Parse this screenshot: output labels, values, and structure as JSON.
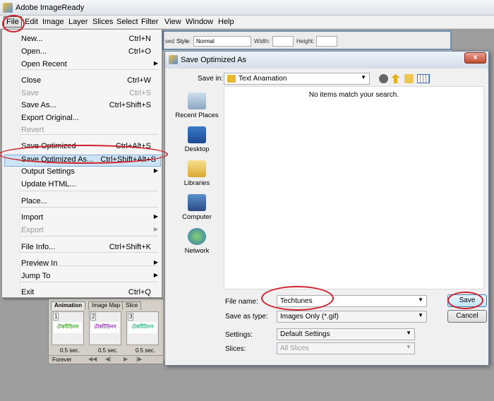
{
  "app": {
    "title": "Adobe ImageReady"
  },
  "menubar": [
    "File",
    "Edit",
    "Image",
    "Layer",
    "Slices",
    "Select",
    "Filter",
    "View",
    "Window",
    "Help"
  ],
  "options_bar": {
    "partial_label": "sed",
    "style_label": "Style:",
    "style_value": "Normal",
    "width_label": "Width:",
    "height_label": "Height:"
  },
  "file_menu": [
    {
      "label": "New...",
      "shortcut": "Ctrl+N"
    },
    {
      "label": "Open...",
      "shortcut": "Ctrl+O"
    },
    {
      "label": "Open Recent",
      "submenu": true
    },
    {
      "label": "Close",
      "shortcut": "Ctrl+W"
    },
    {
      "label": "Save",
      "shortcut": "Ctrl+S",
      "disabled": true
    },
    {
      "label": "Save As...",
      "shortcut": "Ctrl+Shift+S"
    },
    {
      "label": "Export Original...",
      "shortcut": ""
    },
    {
      "label": "Revert",
      "disabled": true
    },
    {
      "label": "Save Optimized",
      "shortcut": "Ctrl+Alt+S"
    },
    {
      "label": "Save Optimized As...",
      "shortcut": "Ctrl+Shift+Alt+S",
      "highlighted": true
    },
    {
      "label": "Output Settings",
      "submenu": true
    },
    {
      "label": "Update HTML..."
    },
    {
      "label": "Place..."
    },
    {
      "label": "Import",
      "submenu": true
    },
    {
      "label": "Export",
      "submenu": true,
      "disabled": true
    },
    {
      "label": "File Info...",
      "shortcut": "Ctrl+Shift+K"
    },
    {
      "label": "Preview In",
      "submenu": true
    },
    {
      "label": "Jump To",
      "submenu": true
    },
    {
      "label": "Exit",
      "shortcut": "Ctrl+Q"
    }
  ],
  "animation_panel": {
    "tabs": [
      "Animation",
      "Image Map",
      "Slice"
    ],
    "frames": [
      {
        "num": "1",
        "text": "টেকটিউনস",
        "color": "#3aa020",
        "delay": "0.5 sec."
      },
      {
        "num": "2",
        "text": "টেকটিউনস",
        "color": "#9a20c0",
        "delay": "0.5 sec."
      },
      {
        "num": "3",
        "text": "টেকটিউনস",
        "color": "#20b080",
        "delay": "0.5 sec."
      }
    ],
    "loop": "Forever"
  },
  "dialog": {
    "title": "Save Optimized As",
    "close": "x",
    "save_in_label": "Save in:",
    "save_in_value": "Text Anamation",
    "places": [
      "Recent Places",
      "Desktop",
      "Libraries",
      "Computer",
      "Network"
    ],
    "empty_message": "No items match your search.",
    "file_name_label": "File name:",
    "file_name_value": "Techtunes",
    "save_type_label": "Save as type:",
    "save_type_value": "Images Only (*.gif)",
    "settings_label": "Settings:",
    "settings_value": "Default Settings",
    "slices_label": "Slices:",
    "slices_value": "All Slices",
    "save_button": "Save",
    "cancel_button": "Cancel"
  },
  "colors": {
    "annotation": "#d0202a",
    "highlight": "#cde4f7"
  }
}
